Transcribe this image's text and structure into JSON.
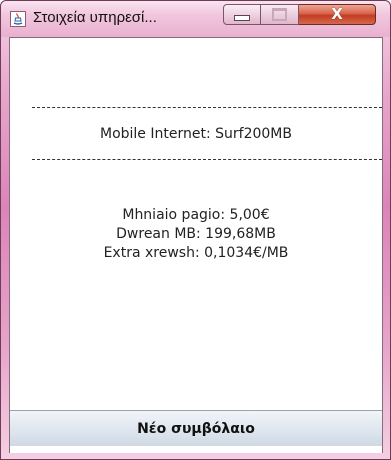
{
  "window": {
    "title": "Στοιχεία υπηρεσί...",
    "icon": "java-app-icon",
    "controls": {
      "minimize_icon": "minimize-icon",
      "maximize_icon": "maximize-icon",
      "close_label": "X"
    }
  },
  "content": {
    "service_line": "Mobile Internet: Surf200MB",
    "details": [
      "Mhniaio pagio: 5,00€",
      "Dwrean MB: 199,68MB",
      "Extra xrewsh: 0,1034€/MB"
    ]
  },
  "actions": {
    "new_contract_label": "Νέο συμβόλαιο"
  },
  "colors": {
    "frame_accent": "#dc84b9",
    "close_button": "#c23c22",
    "button_face": "#e0e7ef"
  }
}
